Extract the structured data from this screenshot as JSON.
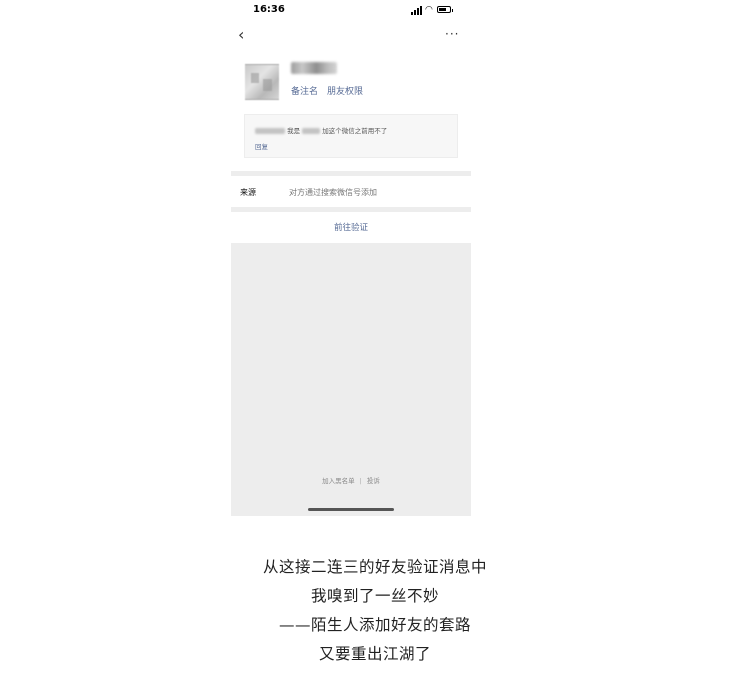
{
  "status_bar": {
    "time": "16:36"
  },
  "nav": {
    "back_icon": "‹",
    "more_icon": "···"
  },
  "profile": {
    "links": [
      "备注名",
      "朋友权限"
    ]
  },
  "request_message": {
    "text_part1": "我是",
    "text_part2": "加这个微信之前用不了",
    "reply_label": "回复"
  },
  "source": {
    "label": "来源",
    "value": "对方通过搜索微信号添加"
  },
  "verify_label": "前往验证",
  "bottom_links": {
    "blacklist": "加入黑名单",
    "separator": "|",
    "complain": "投诉"
  },
  "caption": {
    "lines": [
      "从这接二连三的好友验证消息中",
      "我嗅到了一丝不妙",
      "——陌生人添加好友的套路",
      "又要重出江湖了"
    ]
  },
  "colors": {
    "link": "#576b95",
    "background_gray": "#ededed"
  }
}
